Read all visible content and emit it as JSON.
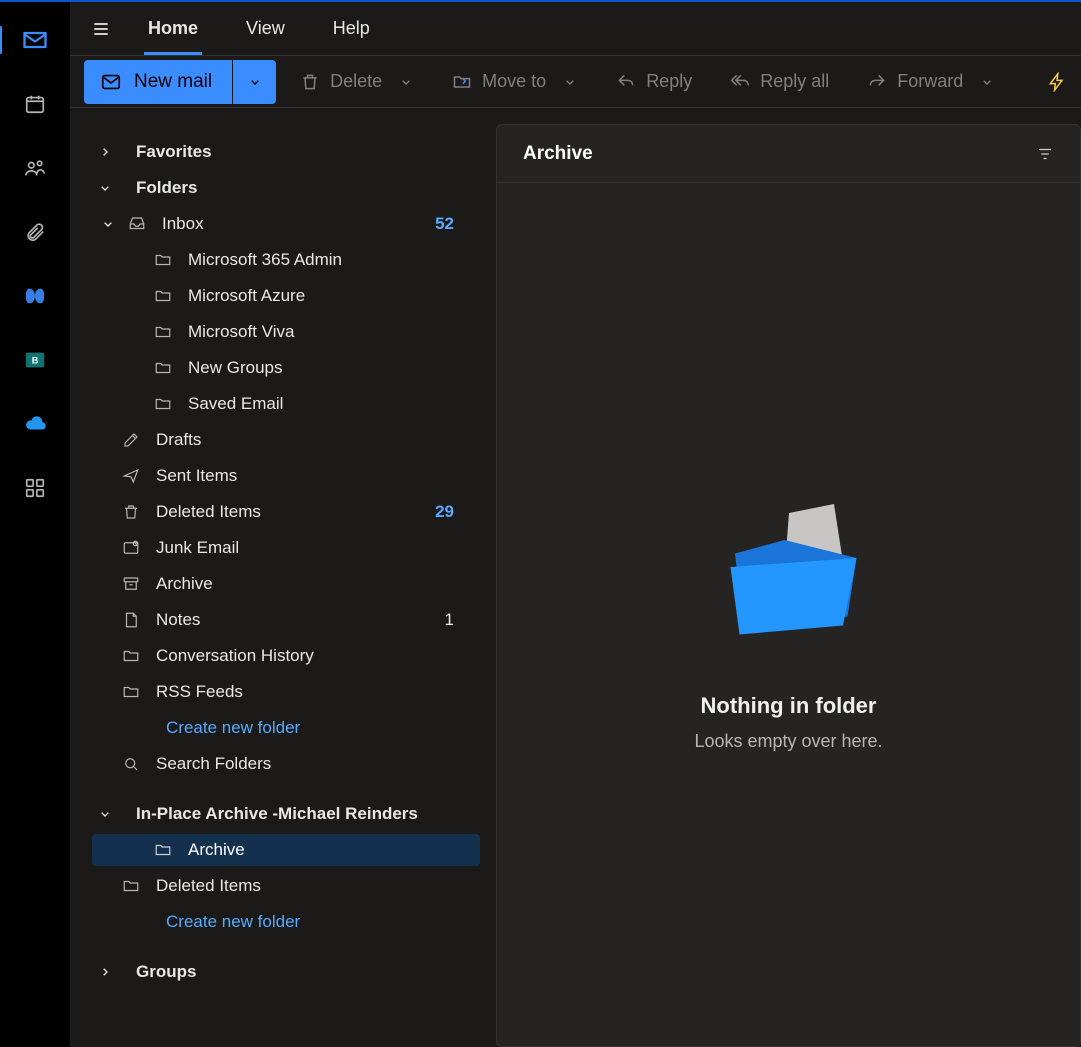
{
  "tabs": {
    "home": "Home",
    "view": "View",
    "help": "Help"
  },
  "toolbar": {
    "new_mail": "New mail",
    "delete": "Delete",
    "move_to": "Move to",
    "reply": "Reply",
    "reply_all": "Reply all",
    "forward": "Forward"
  },
  "nav": {
    "favorites": "Favorites",
    "folders": "Folders",
    "archive_account": "In-Place Archive -Michael Reinders",
    "groups": "Groups"
  },
  "folders": {
    "inbox": {
      "label": "Inbox",
      "count": "52"
    },
    "sub0": "Microsoft 365 Admin",
    "sub1": "Microsoft Azure",
    "sub2": "Microsoft Viva",
    "sub3": "New Groups",
    "sub4": "Saved Email",
    "drafts": "Drafts",
    "sent": "Sent Items",
    "deleted": {
      "label": "Deleted Items",
      "count": "29"
    },
    "junk": "Junk Email",
    "archive": "Archive",
    "notes": {
      "label": "Notes",
      "count": "1"
    },
    "conv": "Conversation History",
    "rss": "RSS Feeds",
    "create": "Create new folder",
    "search_folders": "Search Folders"
  },
  "archive_folders": {
    "archive": "Archive",
    "deleted": "Deleted Items",
    "create": "Create new folder"
  },
  "reading": {
    "title": "Archive",
    "empty_title": "Nothing in folder",
    "empty_sub": "Looks empty over here."
  }
}
